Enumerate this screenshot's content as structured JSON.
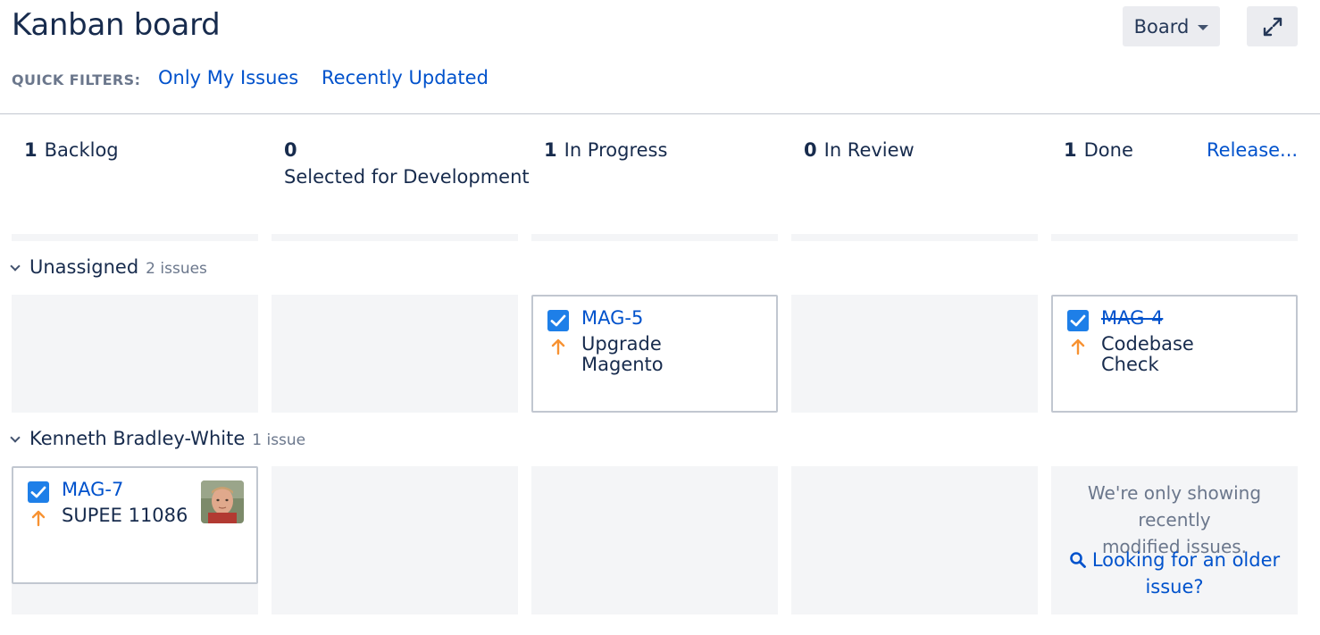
{
  "header": {
    "title": "Kanban board",
    "board_button": "Board"
  },
  "icons": {
    "expand": "expand-arrows-icon",
    "chevron": "chevron-down-icon",
    "checkbox": "task-checkbox-icon",
    "priority": "priority-high-arrow-icon",
    "search": "search-icon"
  },
  "quick_filters": {
    "label": "QUICK FILTERS:",
    "items": [
      "Only My Issues",
      "Recently Updated"
    ]
  },
  "columns": [
    {
      "count": "1",
      "name": "Backlog"
    },
    {
      "count": "0",
      "name": "Selected for Development"
    },
    {
      "count": "1",
      "name": "In Progress"
    },
    {
      "count": "0",
      "name": "In Review"
    },
    {
      "count": "1",
      "name": "Done"
    }
  ],
  "release_link": "Release...",
  "swimlanes": [
    {
      "name": "Unassigned",
      "count": "2 issues"
    },
    {
      "name": "Kenneth Bradley-White",
      "count": "1 issue"
    }
  ],
  "cards": {
    "mag5": {
      "key": "MAG-5",
      "summary_line1": "Upgrade",
      "summary_line2": "Magento"
    },
    "mag4": {
      "key": "MAG-4",
      "summary_line1": "Codebase",
      "summary_line2": "Check"
    },
    "mag7": {
      "key": "MAG-7",
      "summary_line1": "SUPEE 11086"
    }
  },
  "done_message": {
    "text_line1": "We're only showing recently",
    "text_line2": "modified issues.",
    "link_line1": "Looking for an older",
    "link_line2": "issue?"
  },
  "colors": {
    "link": "#0052cc",
    "checkbox": "#1e7fe8",
    "priority": "#f79232",
    "cell_bg": "#f4f5f7"
  }
}
